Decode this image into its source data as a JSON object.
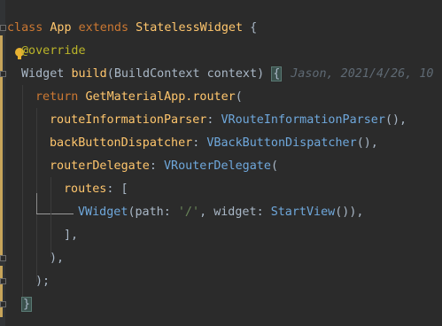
{
  "editor": {
    "line1": {
      "kw_class": "class",
      "name": "App",
      "kw_extends": "extends",
      "parent": "StatelessWidget",
      "brace": "{"
    },
    "line2": {
      "annotation": "@override"
    },
    "line3": {
      "type": "Widget",
      "method": "build",
      "open": "(",
      "param_type": "BuildContext",
      "param_name": "context",
      "close": ")",
      "brace": "{",
      "blame": "Jason, 2021/4/26, 10"
    },
    "line4": {
      "kw_return": "return",
      "call": "GetMaterialApp.router",
      "open": "("
    },
    "line5": {
      "arg": "routeInformationParser",
      "colon": ":",
      "ctor": "VRouteInformationParser",
      "tail": "(),"
    },
    "line6": {
      "arg": "backButtonDispatcher",
      "colon": ":",
      "ctor": "VBackButtonDispatcher",
      "tail": "(),"
    },
    "line7": {
      "arg": "routerDelegate",
      "colon": ":",
      "ctor": "VRouterDelegate",
      "tail": "("
    },
    "line8": {
      "arg": "routes",
      "colon": ":",
      "tail": "["
    },
    "line9": {
      "ctor": "VWidget",
      "open": "(",
      "arg1": "path",
      "colon1": ":",
      "str": "'/'",
      "comma": ",",
      "arg2": "widget",
      "colon2": ":",
      "ctor2": "StartView",
      "tail": "()),"
    },
    "line10": {
      "text": "],"
    },
    "line11": {
      "text": "),"
    },
    "line12": {
      "text": ");"
    },
    "line13": {
      "text": "}"
    },
    "colors": {
      "background": "#2b2b2b",
      "keyword": "#cc7832",
      "function": "#ffc66d",
      "constructor": "#6fa8dc",
      "string": "#6a8759",
      "annotation": "#bbb529",
      "default": "#a9b7c6",
      "hint": "#5f6a74",
      "change_bar": "#c8a55a"
    },
    "icons": [
      "override-gutter-icon",
      "fold-marker-icon"
    ]
  }
}
